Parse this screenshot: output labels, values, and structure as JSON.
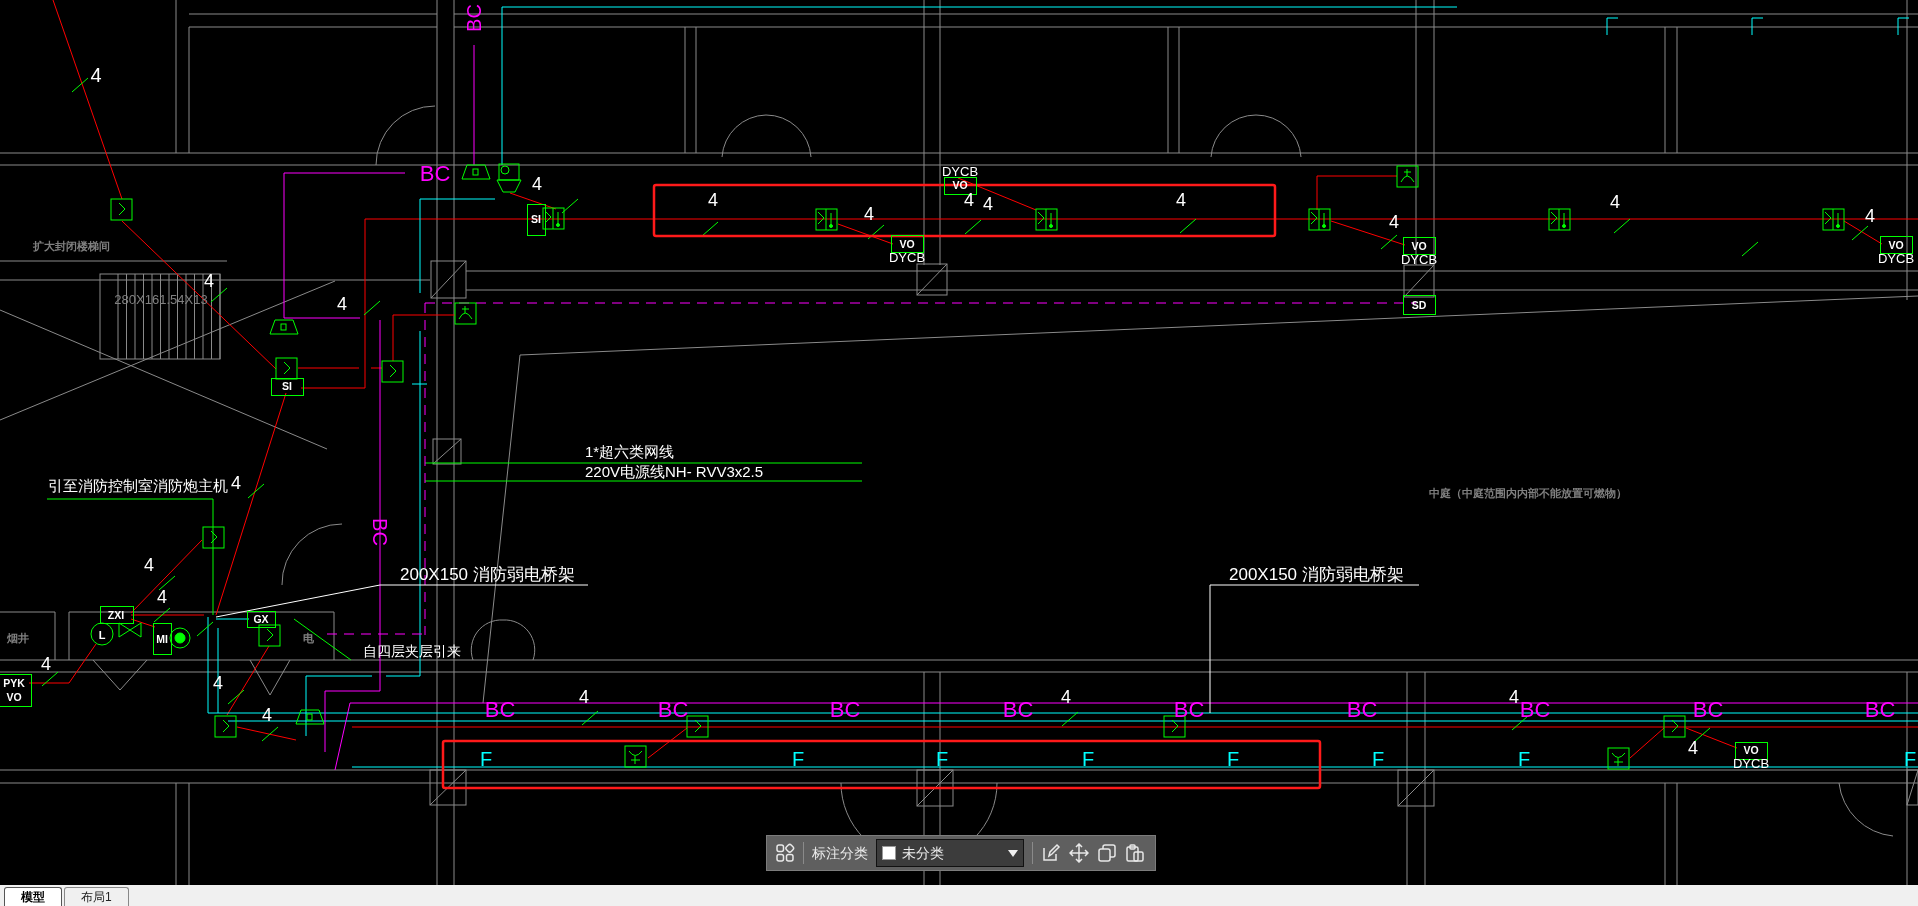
{
  "drawing": {
    "labels": [
      {
        "text": "BC",
        "color": "#ff00ff"
      },
      {
        "text": "4",
        "color": "#ffffff"
      },
      {
        "text": "BC",
        "color": "#ff00ff"
      },
      {
        "text": "4",
        "color": "#ffffff"
      },
      {
        "text": "SI",
        "color": "#ffffff"
      },
      {
        "text": "扩大封闭楼梯间",
        "color": "#808080"
      },
      {
        "text": "4",
        "color": "#ffffff"
      },
      {
        "text": "280X161.54X13",
        "color": "#808080"
      },
      {
        "text": "4",
        "color": "#ffffff"
      },
      {
        "text": "SI",
        "color": "#ffffff"
      },
      {
        "text": "DYCB",
        "color": "#ffffff"
      },
      {
        "text": "VO",
        "color": "#ffffff"
      },
      {
        "text": "4",
        "color": "#ffffff"
      },
      {
        "text": "4",
        "color": "#ffffff"
      },
      {
        "text": "4",
        "color": "#ffffff"
      },
      {
        "text": "4",
        "color": "#ffffff"
      },
      {
        "text": "4",
        "color": "#ffffff"
      },
      {
        "text": "VO",
        "color": "#ffffff"
      },
      {
        "text": "DYCB",
        "color": "#ffffff"
      },
      {
        "text": "4",
        "color": "#ffffff"
      },
      {
        "text": "VO",
        "color": "#ffffff"
      },
      {
        "text": "DYCB",
        "color": "#ffffff"
      },
      {
        "text": "SD",
        "color": "#ffffff"
      },
      {
        "text": "4",
        "color": "#ffffff"
      },
      {
        "text": "4",
        "color": "#ffffff"
      },
      {
        "text": "VO",
        "color": "#ffffff"
      },
      {
        "text": "DYCB",
        "color": "#ffffff"
      },
      {
        "text": "1*超六类网线",
        "color": "#ffffff"
      },
      {
        "text": "220V电源线NH- RVV3x2.5",
        "color": "#ffffff"
      },
      {
        "text": "中庭（中庭范围内内部不能放置可燃物）",
        "color": "#808080"
      },
      {
        "text": "引至消防控制室消防炮主机",
        "color": "#ffffff"
      },
      {
        "text": "4",
        "color": "#ffffff"
      },
      {
        "text": "BC",
        "color": "#ff00ff"
      },
      {
        "text": "200X150 消防弱电桥架",
        "color": "#ffffff"
      },
      {
        "text": "200X150 消防弱电桥架",
        "color": "#ffffff"
      },
      {
        "text": "4",
        "color": "#ffffff"
      },
      {
        "text": "4",
        "color": "#ffffff"
      },
      {
        "text": "ZXI",
        "color": "#ffffff"
      },
      {
        "text": "GX",
        "color": "#ffffff"
      },
      {
        "text": "烟井",
        "color": "#808080"
      },
      {
        "text": "L",
        "color": "#ffffff"
      },
      {
        "text": "MI",
        "color": "#ffffff"
      },
      {
        "text": "电",
        "color": "#808080"
      },
      {
        "text": "自四层夹层引来",
        "color": "#ffffff"
      },
      {
        "text": "4",
        "color": "#ffffff"
      },
      {
        "text": "PYK",
        "color": "#ffffff"
      },
      {
        "text": "VO",
        "color": "#ffffff"
      },
      {
        "text": "4",
        "color": "#ffffff"
      },
      {
        "text": "4",
        "color": "#ffffff"
      },
      {
        "text": "BC",
        "color": "#ff00ff"
      },
      {
        "text": "4",
        "color": "#ffffff"
      },
      {
        "text": "BC",
        "color": "#ff00ff"
      },
      {
        "text": "BC",
        "color": "#ff00ff"
      },
      {
        "text": "BC",
        "color": "#ff00ff"
      },
      {
        "text": "4",
        "color": "#ffffff"
      },
      {
        "text": "BC",
        "color": "#ff00ff"
      },
      {
        "text": "BC",
        "color": "#ff00ff"
      },
      {
        "text": "4",
        "color": "#ffffff"
      },
      {
        "text": "BC",
        "color": "#ff00ff"
      },
      {
        "text": "BC",
        "color": "#ff00ff"
      },
      {
        "text": "BC",
        "color": "#ff00ff"
      },
      {
        "text": "F",
        "color": "#00ffff"
      },
      {
        "text": "F",
        "color": "#00ffff"
      },
      {
        "text": "F",
        "color": "#00ffff"
      },
      {
        "text": "F",
        "color": "#00ffff"
      },
      {
        "text": "F",
        "color": "#00ffff"
      },
      {
        "text": "F",
        "color": "#00ffff"
      },
      {
        "text": "F",
        "color": "#00ffff"
      },
      {
        "text": "F",
        "color": "#00ffff"
      },
      {
        "text": "4",
        "color": "#ffffff"
      },
      {
        "text": "VO",
        "color": "#ffffff"
      },
      {
        "text": "DYCB",
        "color": "#ffffff"
      }
    ]
  },
  "annotation_toolbar": {
    "label": "标注分类",
    "category": "未分类"
  },
  "layout_tabs": [
    {
      "label": "模型",
      "selected": true
    },
    {
      "label": "布局1",
      "selected": false
    }
  ]
}
